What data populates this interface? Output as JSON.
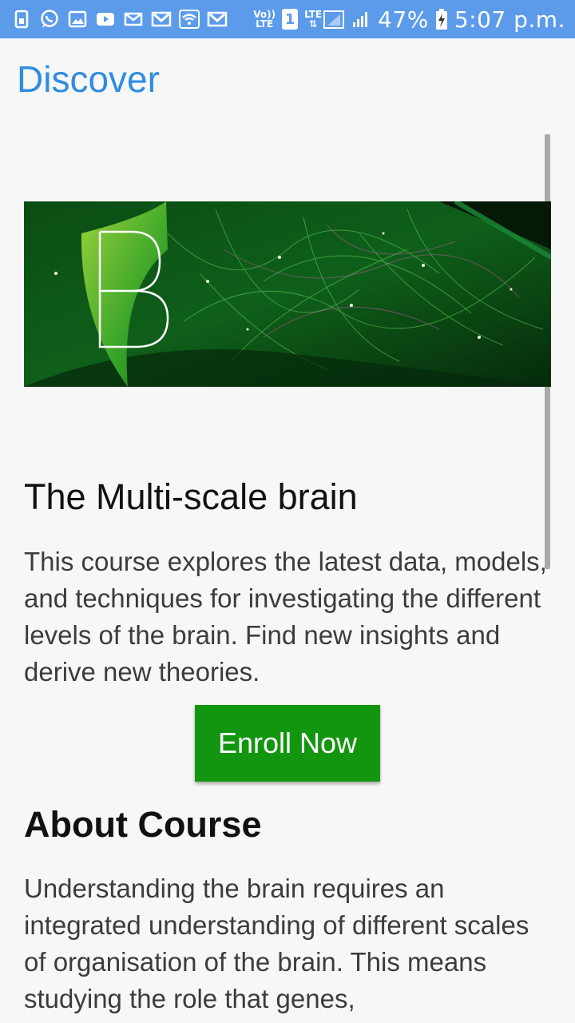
{
  "status_bar": {
    "network_label_top": "Vo))",
    "network_label_bottom": "LTE",
    "sim_slot": "1",
    "lte_label": "LTE",
    "battery_percent": "47%",
    "time": "5:07 p.m.",
    "background_color": "#5b9bea",
    "notification_icons": [
      "sim-card-icon",
      "whatsapp-icon",
      "gallery-icon",
      "youtube-icon",
      "email-icon",
      "gmail-icon",
      "wifi-icon",
      "gmail-icon"
    ]
  },
  "header": {
    "title": "Discover",
    "title_color": "#2f8de0"
  },
  "course": {
    "banner_icon": "brain-course-logo-icon",
    "title": "The Multi-scale brain",
    "description": "This course explores the latest data, models, and techniques for investigating the different levels of the brain. Find new insights and derive new theories.",
    "enroll_label": "Enroll Now",
    "enroll_color": "#13960f"
  },
  "about": {
    "title": "About Course",
    "description": "Understanding the brain requires an integrated understanding of different scales of organisation of the brain. This means studying the role that genes,"
  }
}
